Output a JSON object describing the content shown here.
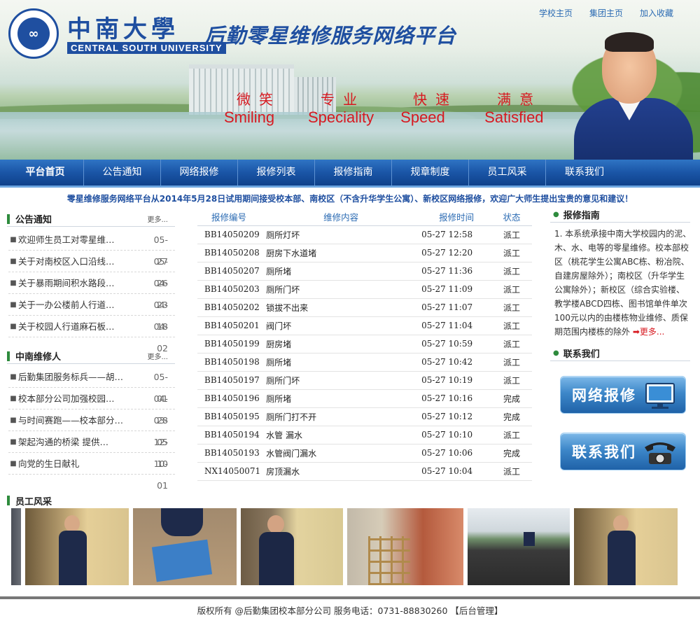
{
  "header": {
    "logo_text": "中南大學",
    "school_en": "CENTRAL SOUTH UNIVERSITY",
    "platform_title": "后勤零星维修服务网络平台",
    "top_links": [
      "学校主页",
      "集团主页",
      "加入收藏"
    ],
    "slogans": [
      {
        "cn": "微笑",
        "en": "Smiling"
      },
      {
        "cn": "专业",
        "en": "Speciality"
      },
      {
        "cn": "快速",
        "en": "Speed"
      },
      {
        "cn": "满意",
        "en": "Satisfied"
      }
    ]
  },
  "nav": {
    "items": [
      "平台首页",
      "公告通知",
      "网络报修",
      "报修列表",
      "报修指南",
      "规章制度",
      "员工风采",
      "联系我们"
    ]
  },
  "notice": "零星维修服务网络平台从2014年5月28日试用期间接受校本部、南校区（不含升华学生公寓）、新校区网络报修，欢迎广大师生提出宝贵的意见和建议！",
  "announcements": {
    "title": "公告通知",
    "more": "更多...",
    "items": [
      {
        "text": "欢迎师生员工对零星维…",
        "date": "05-27"
      },
      {
        "text": "关于对南校区入口沿线…",
        "date": "05-26"
      },
      {
        "text": "关于暴雨期间积水路段…",
        "date": "04-23"
      },
      {
        "text": "关于一办公楼前人行道…",
        "date": "04-18"
      },
      {
        "text": "关于校园人行道麻石板…",
        "date": "04-02"
      }
    ]
  },
  "repairman": {
    "title": "中南维修人",
    "more": "更多...",
    "items": [
      {
        "text": "后勤集团服务标兵——胡…",
        "date": "05-01"
      },
      {
        "text": "校本部分公司加强校园…",
        "date": "04-28"
      },
      {
        "text": "与时间赛跑——校本部分…",
        "date": "03-05"
      },
      {
        "text": "架起沟通的桥梁  提供…",
        "date": "12-10"
      },
      {
        "text": "向党的生日献礼",
        "date": "10-01"
      }
    ]
  },
  "repair_table": {
    "headers": [
      "报修编号",
      "维修内容",
      "报修时间",
      "状态"
    ],
    "rows": [
      [
        "BB14050209",
        "厕所灯坏",
        "05-27 12:58",
        "派工"
      ],
      [
        "BB14050208",
        "厨房下水道堵",
        "05-27 12:20",
        "派工"
      ],
      [
        "BB14050207",
        "厕所堵",
        "05-27 11:36",
        "派工"
      ],
      [
        "BB14050203",
        "厕所门坏",
        "05-27 11:09",
        "派工"
      ],
      [
        "BB14050202",
        "锁拔不出来",
        "05-27 11:07",
        "派工"
      ],
      [
        "BB14050201",
        "阀门坏",
        "05-27 11:04",
        "派工"
      ],
      [
        "BB14050199",
        "厨房堵",
        "05-27 10:59",
        "派工"
      ],
      [
        "BB14050198",
        "厕所堵",
        "05-27 10:42",
        "派工"
      ],
      [
        "BB14050197",
        "厕所门坏",
        "05-27 10:19",
        "派工"
      ],
      [
        "BB14050196",
        "厕所堵",
        "05-27 10:16",
        "完成"
      ],
      [
        "BB14050195",
        "厕所门打不开",
        "05-27 10:12",
        "完成"
      ],
      [
        "BB14050194",
        "水管 漏水",
        "05-27 10:10",
        "派工"
      ],
      [
        "BB14050193",
        "水管阀门漏水",
        "05-27 10:06",
        "完成"
      ],
      [
        "NX14050071",
        "房顶漏水",
        "05-27 10:04",
        "派工"
      ]
    ]
  },
  "guide": {
    "title": "报修指南",
    "text": "1. 本系统承接中南大学校园内的泥、木、水、电等的零星维修。校本部校区（桃花学生公寓ABC栋、粉冶院、自建房屋除外）；南校区（升华学生公寓除外）；新校区（综合实验楼、教学楼ABCD四栋、图书馆单件单次100元以内的由楼栋物业维修、质保期范围内楼栋的除外",
    "more": "➡更多..."
  },
  "contact": {
    "title": "联系我们",
    "buttons": [
      "网络报修",
      "联系我们"
    ]
  },
  "staff": {
    "title": "员工风采"
  },
  "footer": {
    "text": "版权所有 @后勤集团校本部分公司  服务电话：0731-88830260  【后台管理】"
  }
}
